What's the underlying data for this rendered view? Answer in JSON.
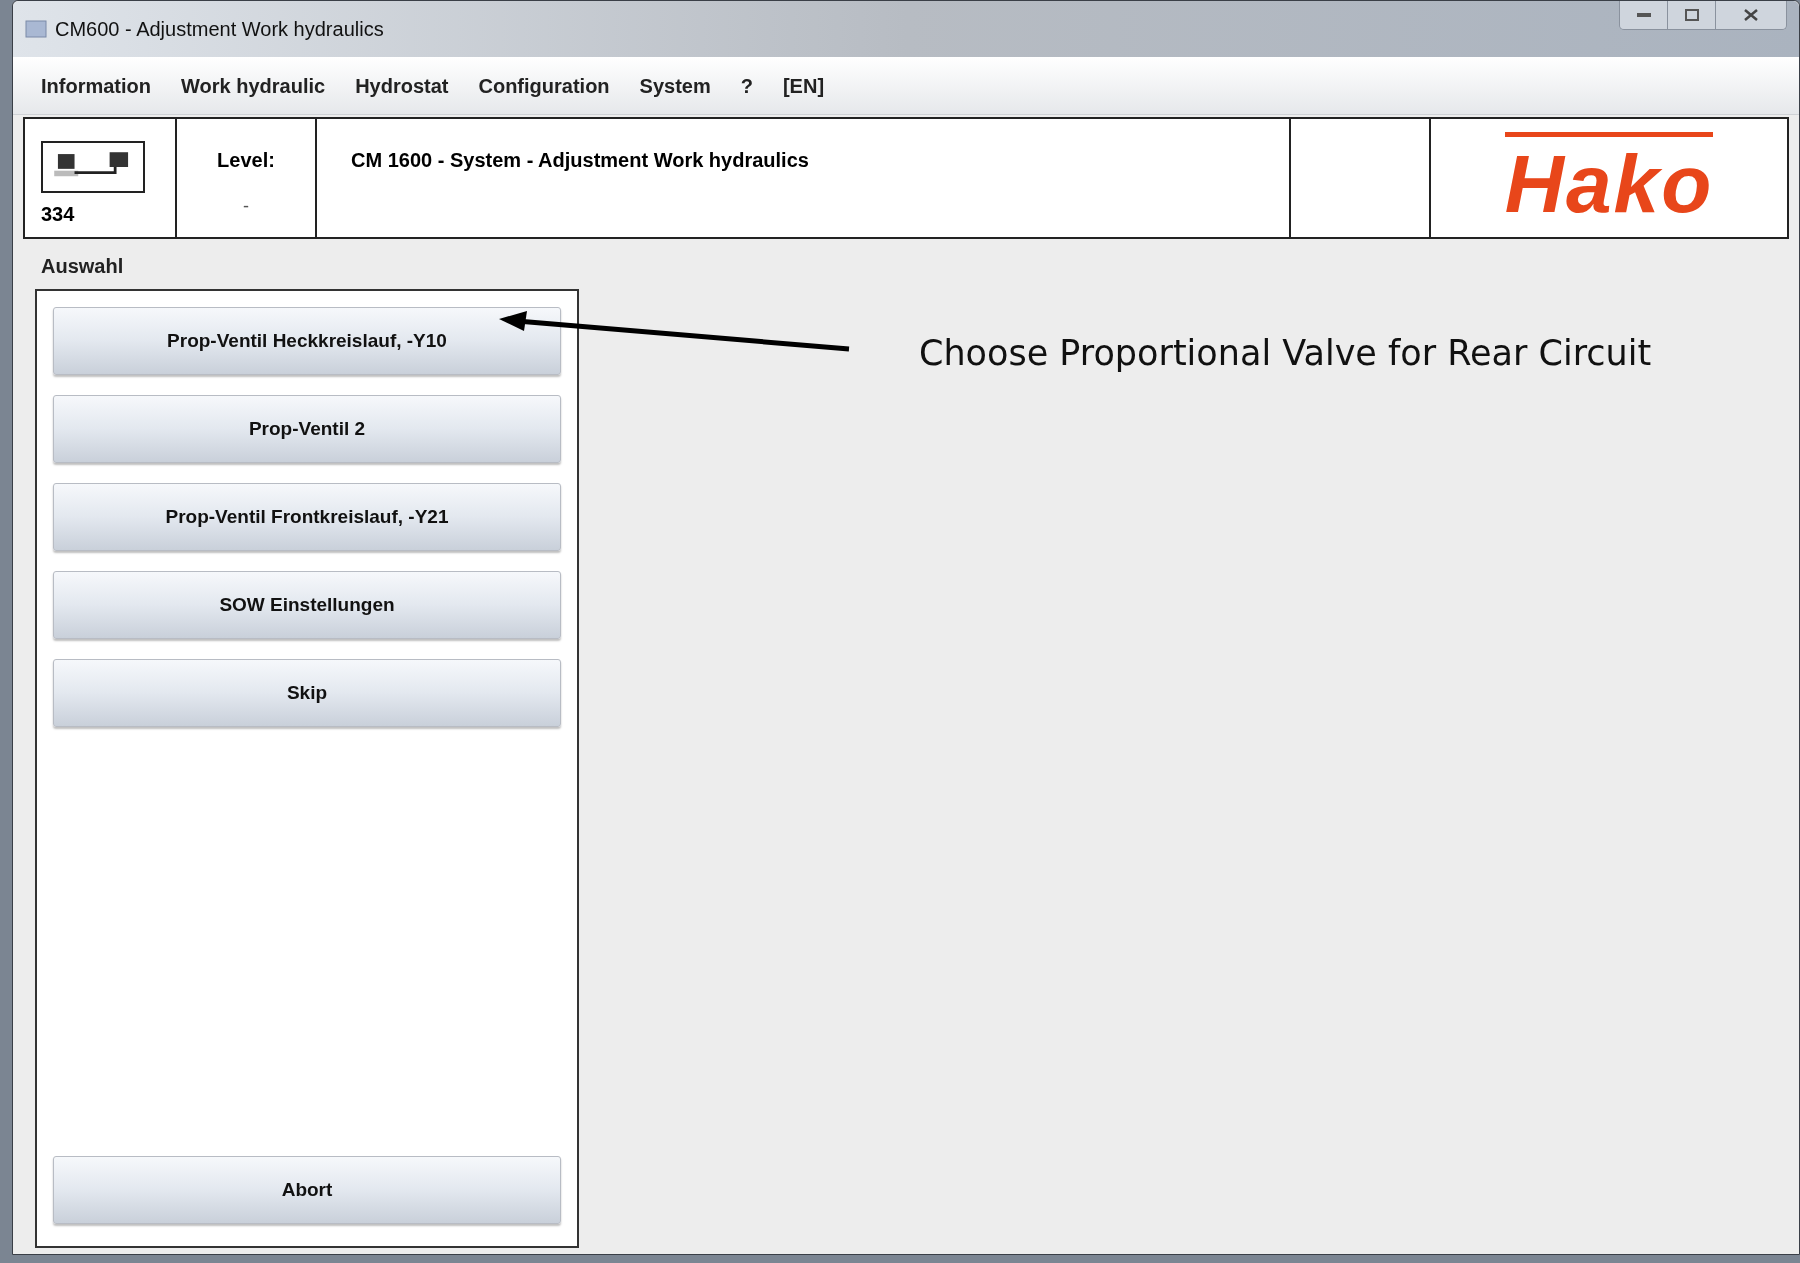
{
  "window": {
    "title": "CM600 - Adjustment Work hydraulics"
  },
  "menu": [
    "Information",
    "Work hydraulic",
    "Hydrostat",
    "Configuration",
    "System",
    "?",
    "[EN]"
  ],
  "header": {
    "number": "334",
    "level_label": "Level:",
    "level_value": "-",
    "title": "CM 1600 - System - Adjustment Work hydraulics",
    "logo": "Hako"
  },
  "selection": {
    "title": "Auswahl",
    "buttons": [
      "Prop-Ventil Heckkreislauf, -Y10",
      "Prop-Ventil 2",
      "Prop-Ventil Frontkreislauf, -Y21",
      "SOW Einstellungen",
      "Skip"
    ],
    "abort": "Abort"
  },
  "annotation": "Choose Proportional Valve for Rear Circuit"
}
